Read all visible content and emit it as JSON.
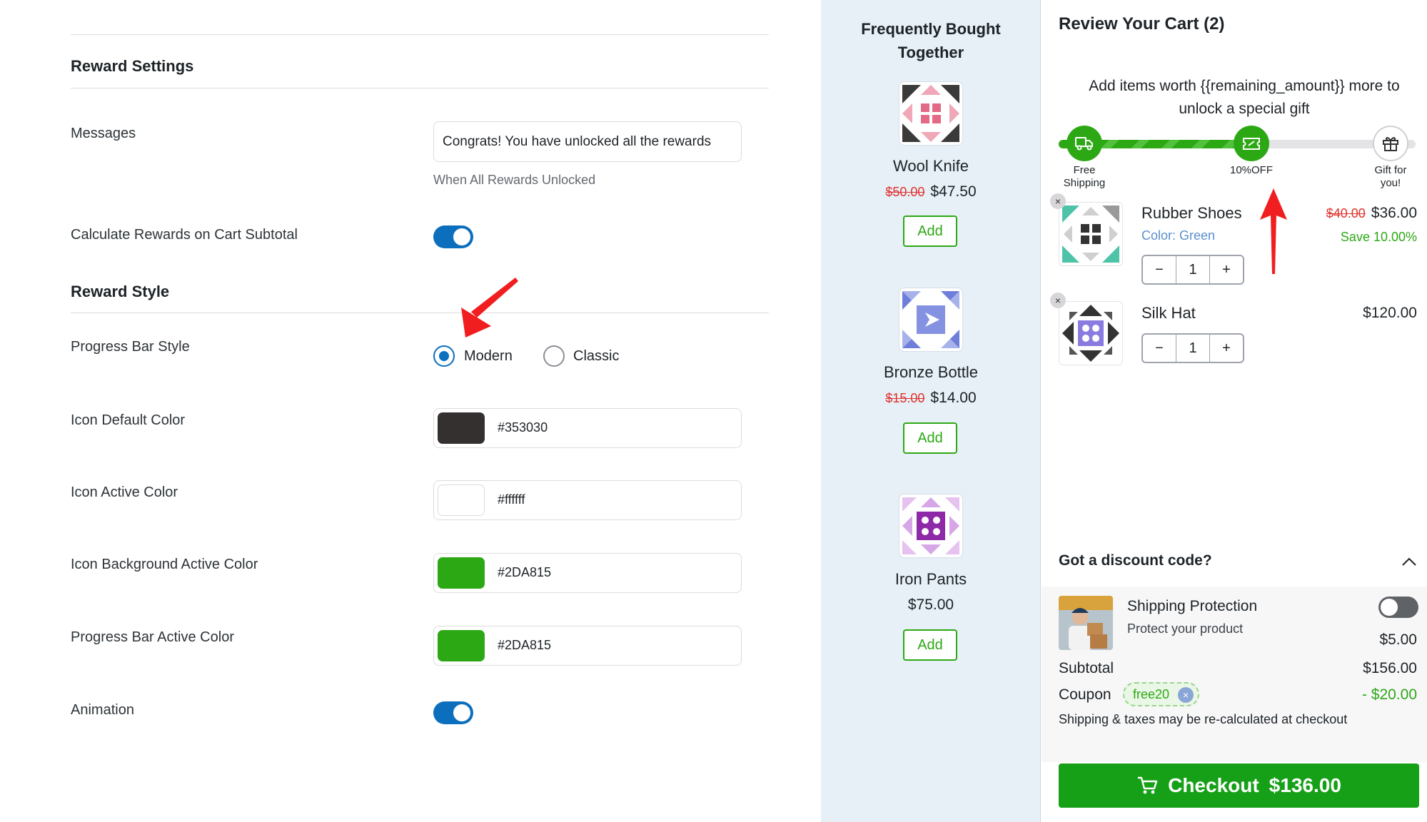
{
  "settings": {
    "reward_settings_title": "Reward Settings",
    "messages_label": "Messages",
    "messages_value": "Congrats! You have unlocked all the rewards",
    "messages_hint": "When All Rewards Unlocked",
    "calc_subtotal_label": "Calculate Rewards on Cart Subtotal",
    "calc_subtotal_on": true,
    "reward_style_title": "Reward Style",
    "progress_style_label": "Progress Bar Style",
    "progress_style_options": [
      "Modern",
      "Classic"
    ],
    "progress_style_selected": "Modern",
    "icon_default_label": "Icon Default Color",
    "icon_default_value": "#353030",
    "icon_active_label": "Icon Active Color",
    "icon_active_value": "#ffffff",
    "icon_bg_active_label": "Icon Background Active Color",
    "icon_bg_active_value": "#2DA815",
    "bar_active_label": "Progress Bar Active Color",
    "bar_active_value": "#2DA815",
    "animation_label": "Animation",
    "animation_on": true
  },
  "fbt": {
    "title_line1": "Frequently Bought",
    "title_line2": "Together",
    "add_label": "Add",
    "products": [
      {
        "name": "Wool Knife",
        "old_price": "$50.00",
        "price": "$47.50",
        "icon": "quilt-pink-icon"
      },
      {
        "name": "Bronze Bottle",
        "old_price": "$15.00",
        "price": "$14.00",
        "icon": "quilt-blue-icon"
      },
      {
        "name": "Iron Pants",
        "old_price": "",
        "price": "$75.00",
        "icon": "quilt-purple-icon"
      }
    ]
  },
  "cart": {
    "title": "Review Your Cart (2)",
    "unlock_message_line1": "Add items worth {{remaining_amount}} more to",
    "unlock_message_line2": "unlock a special gift",
    "progress_fraction": 0.5,
    "milestones": [
      {
        "label_line1": "Free",
        "label_line2": "Shipping",
        "icon": "truck-icon",
        "active": true
      },
      {
        "label_line1": "10%OFF",
        "label_line2": "",
        "icon": "ticket-icon",
        "active": true
      },
      {
        "label_line1": "Gift for",
        "label_line2": "you!",
        "icon": "gift-icon",
        "active": false
      }
    ],
    "items": [
      {
        "name": "Rubber Shoes",
        "variant": "Color: Green",
        "old_price": "$40.00",
        "price": "$36.00",
        "save": "Save 10.00%",
        "qty": "1"
      },
      {
        "name": "Silk Hat",
        "variant": "",
        "old_price": "",
        "price": "$120.00",
        "save": "",
        "qty": "1"
      }
    ],
    "qty_minus": "−",
    "qty_plus": "+",
    "remove_glyph": "×",
    "discount_label": "Got a discount code?",
    "shipping_protection": {
      "title": "Shipping Protection",
      "subtitle": "Protect your product",
      "price": "$5.00",
      "enabled": false
    },
    "subtotal_label": "Subtotal",
    "subtotal_value": "$156.00",
    "coupon_label": "Coupon",
    "coupon_code": "free20",
    "coupon_value": "-  $20.00",
    "shipping_note": "Shipping & taxes may be re-calculated at checkout",
    "checkout_label": "Checkout",
    "checkout_total": "$136.00"
  },
  "colors": {
    "accent_blue": "#0b6fbe",
    "brand_green": "#2DA815",
    "checkout_green": "#16a017",
    "sale_red": "#e0322e",
    "arrow_red": "#f01e1e"
  }
}
